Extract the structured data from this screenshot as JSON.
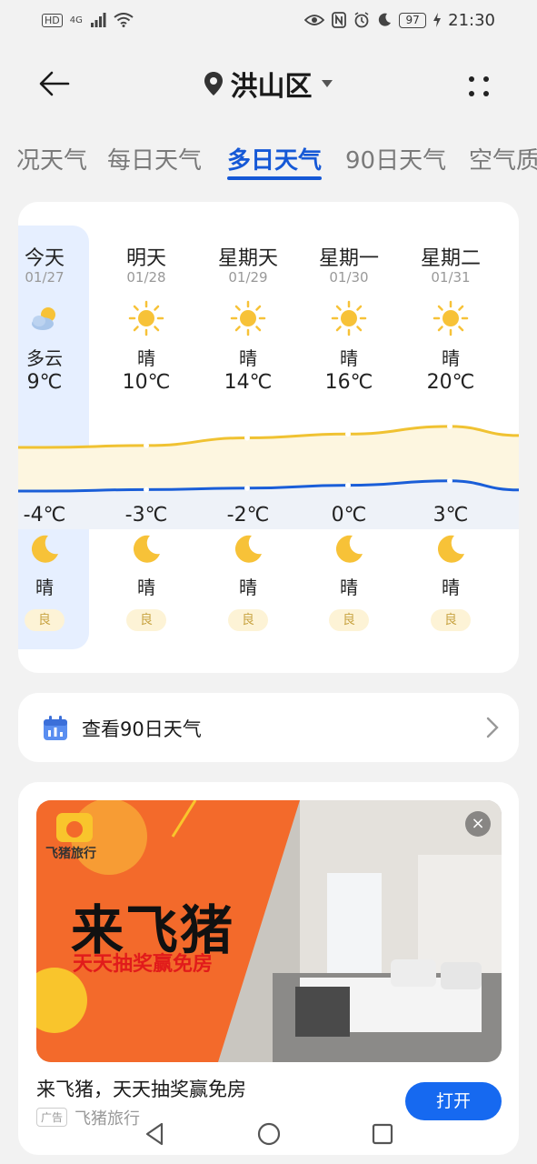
{
  "status_bar": {
    "left_badge": "HD",
    "signal": "4G",
    "battery": "97",
    "time": "21:30"
  },
  "header": {
    "location": "洪山区"
  },
  "tabs": [
    {
      "label": "况天气"
    },
    {
      "label": "每日天气"
    },
    {
      "label": "多日天气",
      "active": true
    },
    {
      "label": "90日天气"
    },
    {
      "label": "空气质"
    }
  ],
  "forecast": {
    "days": [
      {
        "name": "今天",
        "date": "01/27",
        "day_cond": "多云",
        "high": "9℃",
        "low": "-4℃",
        "night_cond": "晴",
        "aqi": "良",
        "high_val": 9,
        "low_val": -4,
        "icon": "partly-cloudy-icon"
      },
      {
        "name": "明天",
        "date": "01/28",
        "day_cond": "晴",
        "high": "10℃",
        "low": "-3℃",
        "night_cond": "晴",
        "aqi": "良",
        "high_val": 10,
        "low_val": -3,
        "icon": "sun-icon"
      },
      {
        "name": "星期天",
        "date": "01/29",
        "day_cond": "晴",
        "high": "14℃",
        "low": "-2℃",
        "night_cond": "晴",
        "aqi": "良",
        "high_val": 14,
        "low_val": -2,
        "icon": "sun-icon"
      },
      {
        "name": "星期一",
        "date": "01/30",
        "day_cond": "晴",
        "high": "16℃",
        "low": "0℃",
        "night_cond": "晴",
        "aqi": "良",
        "high_val": 16,
        "low_val": 0,
        "icon": "sun-icon"
      },
      {
        "name": "星期二",
        "date": "01/31",
        "day_cond": "晴",
        "high": "20℃",
        "low": "3℃",
        "night_cond": "晴",
        "aqi": "良",
        "high_val": 20,
        "low_val": 3,
        "icon": "sun-icon"
      }
    ]
  },
  "row90": {
    "label": "查看90日天气"
  },
  "ad": {
    "brand_small": "飞猪旅行",
    "headline": "来飞猪",
    "sub": "天天抽奖赢免房",
    "title": "来飞猪，天天抽奖赢免房",
    "tag": "广告",
    "source": "飞猪旅行",
    "open_label": "打开"
  },
  "colors": {
    "accent": "#1558d6",
    "high_line": "#f0c232",
    "low_line": "#1a5ed8",
    "button": "#1669f0"
  }
}
